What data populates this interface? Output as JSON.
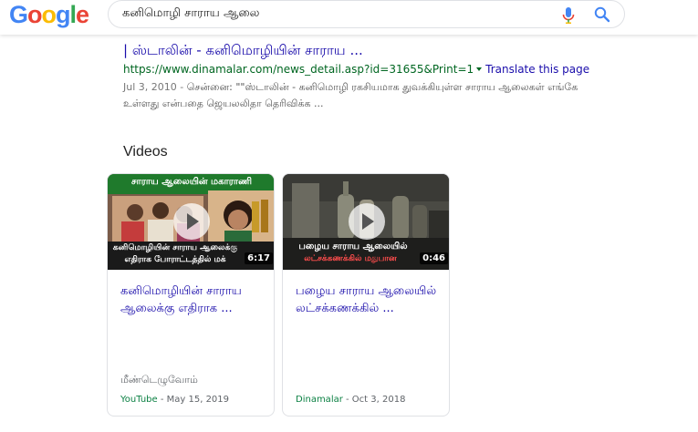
{
  "header": {
    "logo_letters": [
      {
        "ch": "G",
        "color": "#4285F4"
      },
      {
        "ch": "o",
        "color": "#EA4335"
      },
      {
        "ch": "o",
        "color": "#FBBC05"
      },
      {
        "ch": "g",
        "color": "#4285F4"
      },
      {
        "ch": "l",
        "color": "#34A853"
      },
      {
        "ch": "e",
        "color": "#EA4335"
      }
    ],
    "search_query": "கனிமொழி சாராய ஆலை",
    "mic_icon": "mic-icon",
    "search_icon": "search-icon"
  },
  "result": {
    "title": "| ஸ்டாலின் - கனிமொழியின் சாராய ...",
    "url": "https://www.dinamalar.com/news_detail.asp?id=31655&Print=1",
    "translate_label": "Translate this page",
    "snippet_date": "Jul 3, 2010 - ",
    "snippet_text": "சென்னை: \"\"ஸ்டாலின் - கனிமொழி ரகசியமாக துவக்கியுள்ள சாராய ஆலைகள் எங்கே உள்ளது என்பதை ஜெயலலிதா தெரிவிக்க ..."
  },
  "videos": {
    "heading": "Videos",
    "items": [
      {
        "thumb_caption_top": "சாராய ஆலையின் மகாராணி",
        "thumb_caption_bottom_1": "கனிமொழியின் சாராய ஆலைக்கு",
        "thumb_caption_bottom_2": "எதிராக போராட்டத்தில் மக்",
        "duration": "6:17",
        "title": "கனிமொழியின் சாராய ஆலைக்கு எதிராக ...",
        "channel": "மீண்டெழுவோம்",
        "source": "YouTube",
        "date": " - May 15, 2019"
      },
      {
        "thumb_caption_bottom_1": "பழைய சாராய ஆலையில்",
        "thumb_caption_bottom_2": "லட்சக்கணக்கில் மதுபான",
        "duration": "0:46",
        "title": "பழைய சாராய ஆலையில் லட்சக்கணக்கில் ...",
        "channel": "",
        "source": "Dinamalar",
        "date": " - Oct 3, 2018"
      }
    ]
  },
  "colors": {
    "link": "#1a0dab",
    "url_green": "#006621",
    "source_green": "#0b8043"
  }
}
